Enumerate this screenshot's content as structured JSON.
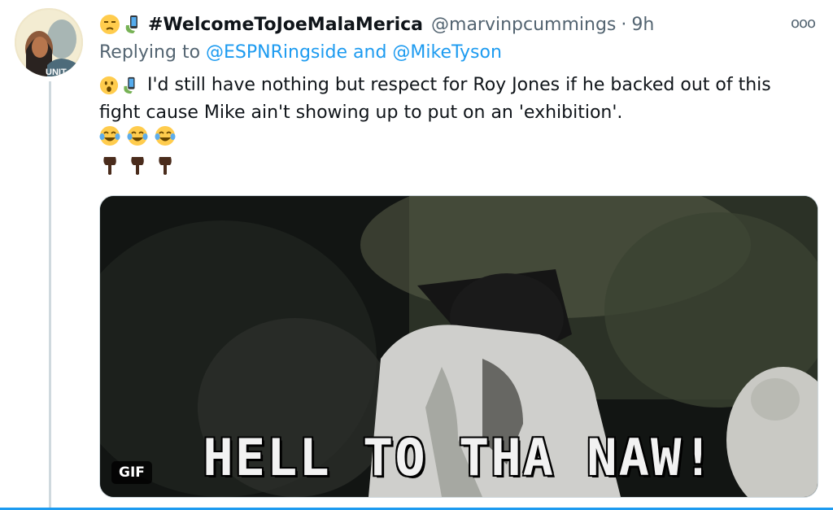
{
  "tweet": {
    "display_name": "#WelcomeToJoeMalaMerica",
    "handle": "@marvinpcummings",
    "separator": "·",
    "time": "9h",
    "more": "ooo",
    "replying_prefix": "Replying to",
    "reply_to_1": "@ESPNRingside",
    "reply_and": "and",
    "reply_to_2": "@MikeTyson",
    "text": "I'd still have nothing but respect for Roy Jones if he backed out of this fight cause Mike ain't showing up to put on an 'exhibition'.",
    "avatar_text": "UNIT"
  },
  "media": {
    "caption": "HELL TO THA NAW!",
    "badge": "GIF"
  },
  "icons": {
    "name_emojis": [
      "unamused-face-icon",
      "mobile-phone-icon"
    ],
    "text_emojis": [
      "hushed-face-icon",
      "mobile-phone-icon"
    ],
    "laugh_row": [
      "tears-of-joy-icon",
      "tears-of-joy-icon",
      "tears-of-joy-icon"
    ],
    "point_row": [
      "point-down-icon",
      "point-down-icon",
      "point-down-icon"
    ]
  },
  "colors": {
    "link": "#1d9bf0",
    "muted": "#536471",
    "text": "#0f1419"
  }
}
